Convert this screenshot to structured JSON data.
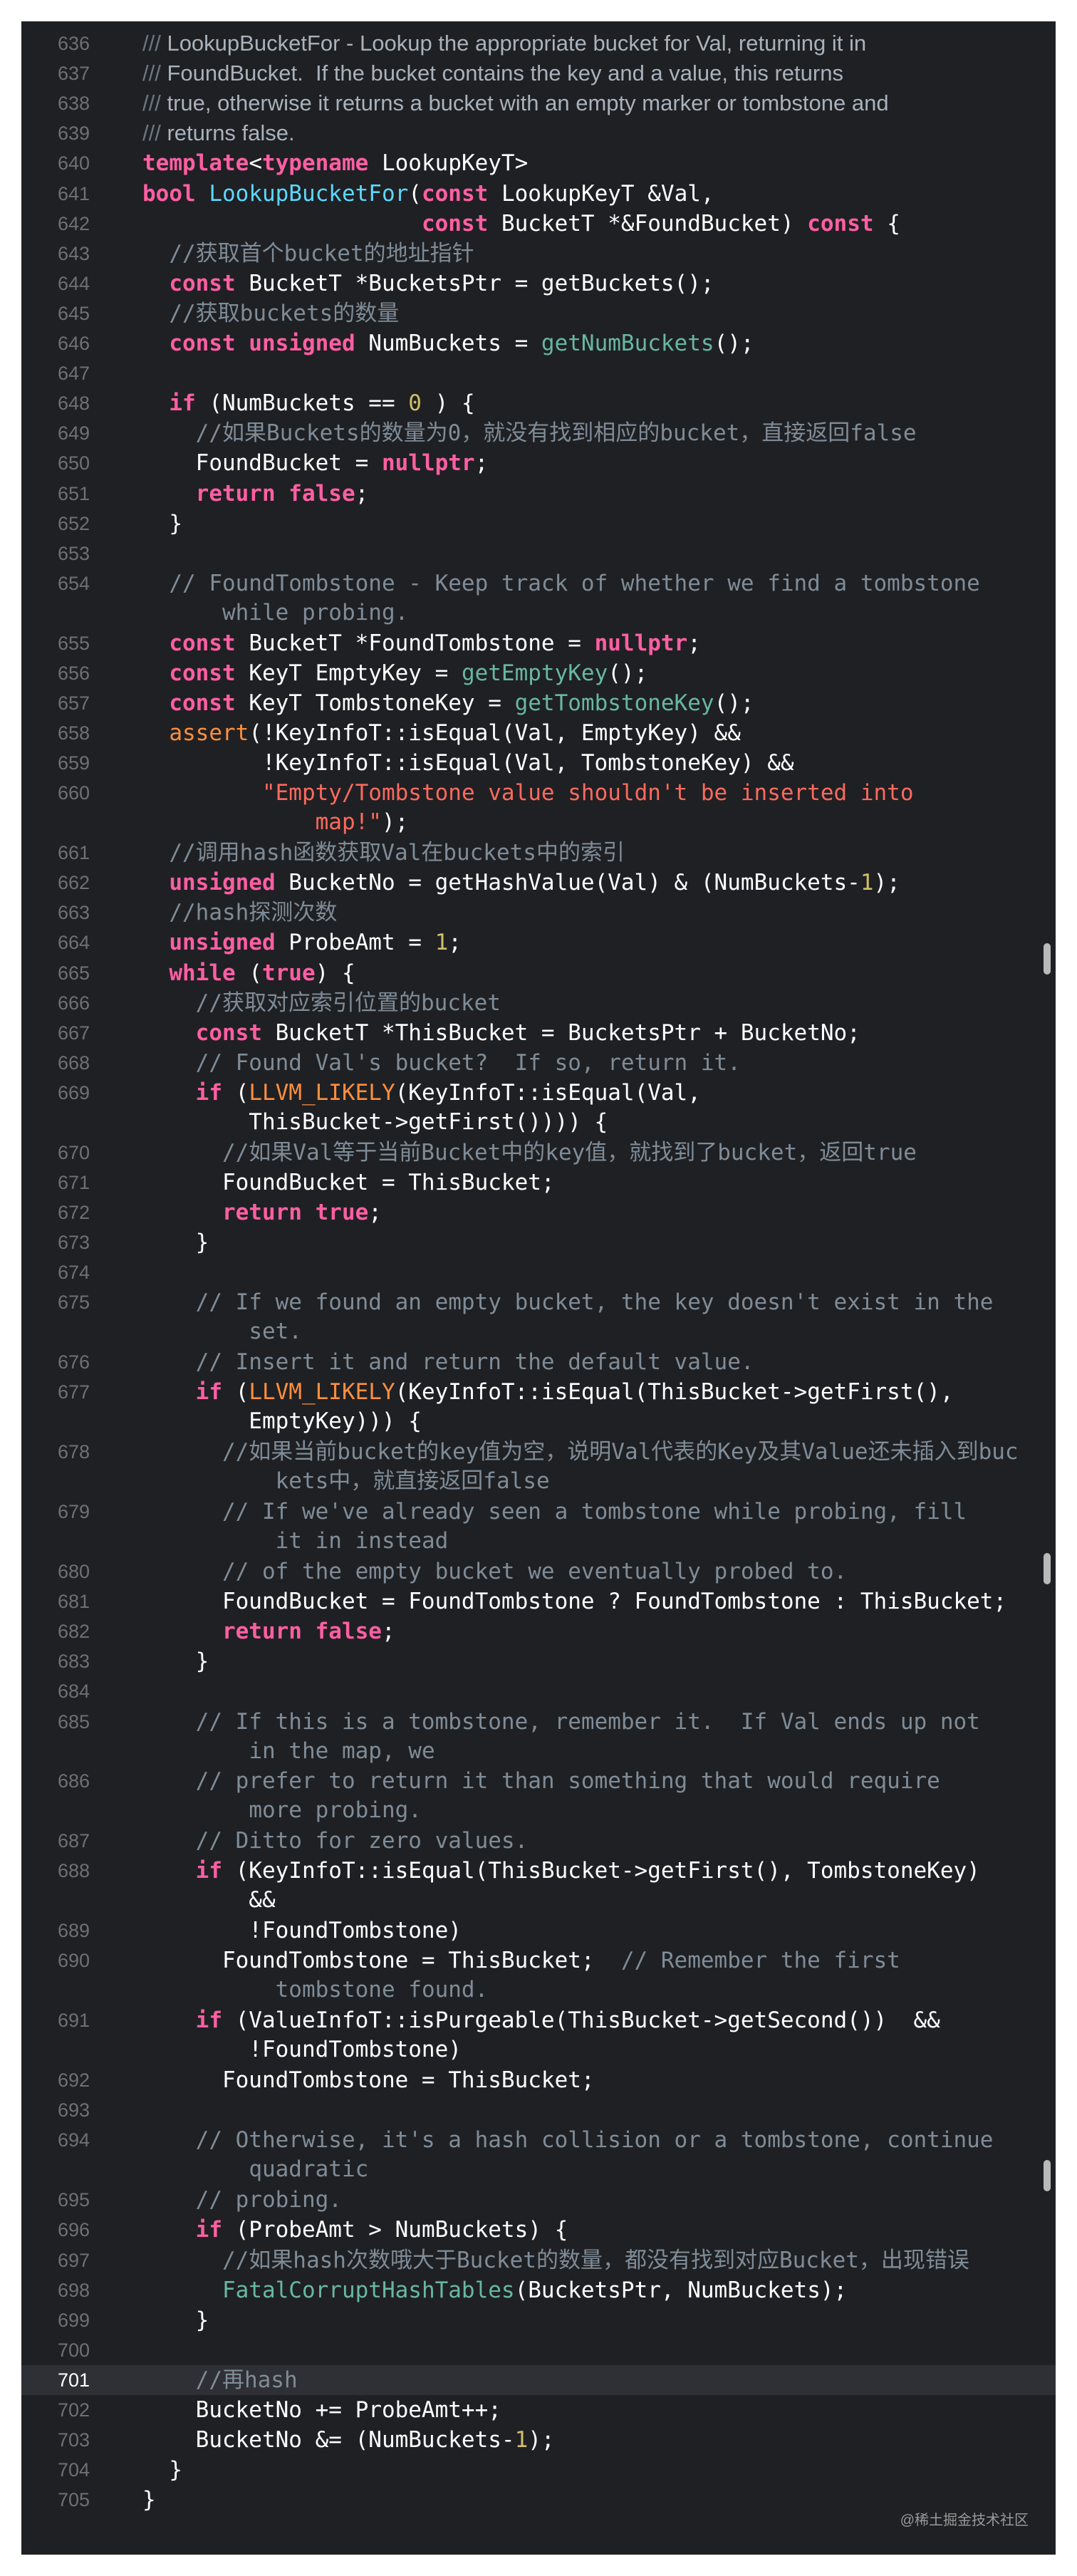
{
  "colors": {
    "background": "#1f2023",
    "keyword": "#fc5fa3",
    "comment": "#7f8c98",
    "string": "#fc6a5d",
    "number": "#d0bf69",
    "function": "#67b7a4",
    "macro": "#fd8f3f",
    "declaration": "#5dd8ff",
    "line_number": "#6e7074",
    "current_line": "#2f3035"
  },
  "editor": {
    "current_line": 701,
    "lines": [
      {
        "num": "636",
        "font": "doc",
        "segs": [
          [
            "cd",
            "/// "
          ],
          [
            "cdt",
            "LookupBucketFor - Lookup the appropriate bucket for Val, returning it in"
          ]
        ]
      },
      {
        "num": "637",
        "font": "doc",
        "segs": [
          [
            "cd",
            "/// "
          ],
          [
            "cdt",
            "FoundBucket.  If the bucket contains the key and a value, this returns"
          ]
        ]
      },
      {
        "num": "638",
        "font": "doc",
        "segs": [
          [
            "cd",
            "/// "
          ],
          [
            "cdt",
            "true, otherwise it returns a bucket with an empty marker or tombstone and"
          ]
        ]
      },
      {
        "num": "639",
        "font": "doc",
        "segs": [
          [
            "cd",
            "/// "
          ],
          [
            "cdt",
            "returns false."
          ]
        ]
      },
      {
        "num": "640",
        "segs": [
          [
            "k",
            "template"
          ],
          [
            "",
            "<"
          ],
          [
            "k",
            "typename"
          ],
          [
            "",
            " LookupKeyT>"
          ]
        ]
      },
      {
        "num": "641",
        "segs": [
          [
            "k",
            "bool"
          ],
          [
            "",
            " "
          ],
          [
            "t",
            "LookupBucketFor"
          ],
          [
            "",
            "("
          ],
          [
            "k",
            "const"
          ],
          [
            "",
            " LookupKeyT &Val,"
          ]
        ]
      },
      {
        "num": "642",
        "segs": [
          [
            "",
            "                     "
          ],
          [
            "k",
            "const"
          ],
          [
            "",
            " BucketT *&FoundBucket) "
          ],
          [
            "k",
            "const"
          ],
          [
            "",
            " {"
          ]
        ]
      },
      {
        "num": "643",
        "segs": [
          [
            "",
            "  "
          ],
          [
            "c",
            "//获取首个bucket的地址指针"
          ]
        ]
      },
      {
        "num": "644",
        "segs": [
          [
            "",
            "  "
          ],
          [
            "k",
            "const"
          ],
          [
            "",
            " BucketT *BucketsPtr = getBuckets();"
          ]
        ]
      },
      {
        "num": "645",
        "segs": [
          [
            "",
            "  "
          ],
          [
            "c",
            "//获取buckets的数量"
          ]
        ]
      },
      {
        "num": "646",
        "segs": [
          [
            "",
            "  "
          ],
          [
            "k",
            "const unsigned"
          ],
          [
            "",
            " NumBuckets = "
          ],
          [
            "f",
            "getNumBuckets"
          ],
          [
            "",
            "();"
          ]
        ]
      },
      {
        "num": "647",
        "segs": []
      },
      {
        "num": "648",
        "segs": [
          [
            "",
            "  "
          ],
          [
            "k",
            "if"
          ],
          [
            "",
            " (NumBuckets == "
          ],
          [
            "n",
            "0"
          ],
          [
            "",
            " ) {"
          ]
        ]
      },
      {
        "num": "649",
        "segs": [
          [
            "",
            "    "
          ],
          [
            "c",
            "//如果Buckets的数量为0，就没有找到相应的bucket，直接返回false"
          ]
        ]
      },
      {
        "num": "650",
        "segs": [
          [
            "",
            "    FoundBucket = "
          ],
          [
            "k",
            "nullptr"
          ],
          [
            "",
            ";"
          ]
        ]
      },
      {
        "num": "651",
        "segs": [
          [
            "",
            "    "
          ],
          [
            "k",
            "return false"
          ],
          [
            "",
            ";"
          ]
        ]
      },
      {
        "num": "652",
        "segs": [
          [
            "",
            "  }"
          ]
        ]
      },
      {
        "num": "653",
        "segs": []
      },
      {
        "num": "654",
        "segs": [
          [
            "",
            "  "
          ],
          [
            "c",
            "// FoundTombstone - Keep track of whether we find a tombstone"
          ]
        ],
        "wrap": [
          [
            "",
            "      "
          ],
          [
            "c",
            "while probing."
          ]
        ]
      },
      {
        "num": "655",
        "segs": [
          [
            "",
            "  "
          ],
          [
            "k",
            "const"
          ],
          [
            "",
            " BucketT *FoundTombstone = "
          ],
          [
            "k",
            "nullptr"
          ],
          [
            "",
            ";"
          ]
        ]
      },
      {
        "num": "656",
        "segs": [
          [
            "",
            "  "
          ],
          [
            "k",
            "const"
          ],
          [
            "",
            " KeyT EmptyKey = "
          ],
          [
            "f",
            "getEmptyKey"
          ],
          [
            "",
            "();"
          ]
        ]
      },
      {
        "num": "657",
        "segs": [
          [
            "",
            "  "
          ],
          [
            "k",
            "const"
          ],
          [
            "",
            " KeyT TombstoneKey = "
          ],
          [
            "f",
            "getTombstoneKey"
          ],
          [
            "",
            "();"
          ]
        ]
      },
      {
        "num": "658",
        "segs": [
          [
            "",
            "  "
          ],
          [
            "m",
            "assert"
          ],
          [
            "",
            "(!KeyInfoT::isEqual(Val, EmptyKey) &&"
          ]
        ]
      },
      {
        "num": "659",
        "segs": [
          [
            "",
            "         !KeyInfoT::isEqual(Val, TombstoneKey) &&"
          ]
        ]
      },
      {
        "num": "660",
        "segs": [
          [
            "",
            "         "
          ],
          [
            "s",
            "\"Empty/Tombstone value shouldn't be inserted into"
          ]
        ],
        "wrap": [
          [
            "",
            "             "
          ],
          [
            "s",
            "map!\""
          ],
          [
            "",
            ");"
          ]
        ]
      },
      {
        "num": "661",
        "segs": [
          [
            "",
            "  "
          ],
          [
            "c",
            "//调用hash函数获取Val在buckets中的索引"
          ]
        ]
      },
      {
        "num": "662",
        "segs": [
          [
            "",
            "  "
          ],
          [
            "k",
            "unsigned"
          ],
          [
            "",
            " BucketNo = getHashValue(Val) & (NumBuckets-"
          ],
          [
            "n",
            "1"
          ],
          [
            "",
            ");"
          ]
        ]
      },
      {
        "num": "663",
        "segs": [
          [
            "",
            "  "
          ],
          [
            "c",
            "//hash探测次数"
          ]
        ]
      },
      {
        "num": "664",
        "segs": [
          [
            "",
            "  "
          ],
          [
            "k",
            "unsigned"
          ],
          [
            "",
            " ProbeAmt = "
          ],
          [
            "n",
            "1"
          ],
          [
            "",
            ";"
          ]
        ]
      },
      {
        "num": "665",
        "segs": [
          [
            "",
            "  "
          ],
          [
            "k",
            "while"
          ],
          [
            "",
            " ("
          ],
          [
            "k",
            "true"
          ],
          [
            "",
            ") {"
          ]
        ]
      },
      {
        "num": "666",
        "segs": [
          [
            "",
            "    "
          ],
          [
            "c",
            "//获取对应索引位置的bucket"
          ]
        ]
      },
      {
        "num": "667",
        "segs": [
          [
            "",
            "    "
          ],
          [
            "k",
            "const"
          ],
          [
            "",
            " BucketT *ThisBucket = BucketsPtr + BucketNo;"
          ]
        ]
      },
      {
        "num": "668",
        "segs": [
          [
            "",
            "    "
          ],
          [
            "c",
            "// Found Val's bucket?  If so, return it."
          ]
        ]
      },
      {
        "num": "669",
        "segs": [
          [
            "",
            "    "
          ],
          [
            "k",
            "if"
          ],
          [
            "",
            " ("
          ],
          [
            "m",
            "LLVM_LIKELY"
          ],
          [
            "",
            "(KeyInfoT::isEqual(Val,"
          ]
        ],
        "wrap": [
          [
            "",
            "        ThisBucket->getFirst()))) {"
          ]
        ]
      },
      {
        "num": "670",
        "segs": [
          [
            "",
            "      "
          ],
          [
            "c",
            "//如果Val等于当前Bucket中的key值，就找到了bucket，返回true"
          ]
        ]
      },
      {
        "num": "671",
        "segs": [
          [
            "",
            "      FoundBucket = ThisBucket;"
          ]
        ]
      },
      {
        "num": "672",
        "segs": [
          [
            "",
            "      "
          ],
          [
            "k",
            "return true"
          ],
          [
            "",
            ";"
          ]
        ]
      },
      {
        "num": "673",
        "segs": [
          [
            "",
            "    }"
          ]
        ]
      },
      {
        "num": "674",
        "segs": []
      },
      {
        "num": "675",
        "segs": [
          [
            "",
            "    "
          ],
          [
            "c",
            "// If we found an empty bucket, the key doesn't exist in the"
          ]
        ],
        "wrap": [
          [
            "",
            "        "
          ],
          [
            "c",
            "set."
          ]
        ]
      },
      {
        "num": "676",
        "segs": [
          [
            "",
            "    "
          ],
          [
            "c",
            "// Insert it and return the default value."
          ]
        ]
      },
      {
        "num": "677",
        "segs": [
          [
            "",
            "    "
          ],
          [
            "k",
            "if"
          ],
          [
            "",
            " ("
          ],
          [
            "m",
            "LLVM_LIKELY"
          ],
          [
            "",
            "(KeyInfoT::isEqual(ThisBucket->getFirst(),"
          ]
        ],
        "wrap": [
          [
            "",
            "        EmptyKey))) {"
          ]
        ]
      },
      {
        "num": "678",
        "segs": [
          [
            "",
            "      "
          ],
          [
            "c",
            "//如果当前bucket的key值为空，说明Val代表的Key及其Value还未插入到buc"
          ]
        ],
        "wrap": [
          [
            "",
            "          "
          ],
          [
            "c",
            "kets中，就直接返回false"
          ]
        ]
      },
      {
        "num": "679",
        "segs": [
          [
            "",
            "      "
          ],
          [
            "c",
            "// If we've already seen a tombstone while probing, fill"
          ]
        ],
        "wrap": [
          [
            "",
            "          "
          ],
          [
            "c",
            "it in instead"
          ]
        ]
      },
      {
        "num": "680",
        "segs": [
          [
            "",
            "      "
          ],
          [
            "c",
            "// of the empty bucket we eventually probed to."
          ]
        ]
      },
      {
        "num": "681",
        "segs": [
          [
            "",
            "      FoundBucket = FoundTombstone ? FoundTombstone : ThisBucket;"
          ]
        ]
      },
      {
        "num": "682",
        "segs": [
          [
            "",
            "      "
          ],
          [
            "k",
            "return false"
          ],
          [
            "",
            ";"
          ]
        ]
      },
      {
        "num": "683",
        "segs": [
          [
            "",
            "    }"
          ]
        ]
      },
      {
        "num": "684",
        "segs": []
      },
      {
        "num": "685",
        "segs": [
          [
            "",
            "    "
          ],
          [
            "c",
            "// If this is a tombstone, remember it.  If Val ends up not"
          ]
        ],
        "wrap": [
          [
            "",
            "        "
          ],
          [
            "c",
            "in the map, we"
          ]
        ]
      },
      {
        "num": "686",
        "segs": [
          [
            "",
            "    "
          ],
          [
            "c",
            "// prefer to return it than something that would require"
          ]
        ],
        "wrap": [
          [
            "",
            "        "
          ],
          [
            "c",
            "more probing."
          ]
        ]
      },
      {
        "num": "687",
        "segs": [
          [
            "",
            "    "
          ],
          [
            "c",
            "// Ditto for zero values."
          ]
        ]
      },
      {
        "num": "688",
        "segs": [
          [
            "",
            "    "
          ],
          [
            "k",
            "if"
          ],
          [
            "",
            " (KeyInfoT::isEqual(ThisBucket->getFirst(), TombstoneKey)"
          ]
        ],
        "wrap": [
          [
            "",
            "        &&"
          ]
        ]
      },
      {
        "num": "689",
        "segs": [
          [
            "",
            "        !FoundTombstone)"
          ]
        ]
      },
      {
        "num": "690",
        "segs": [
          [
            "",
            "      FoundTombstone = ThisBucket;  "
          ],
          [
            "c",
            "// Remember the first"
          ]
        ],
        "wrap": [
          [
            "",
            "          "
          ],
          [
            "c",
            "tombstone found."
          ]
        ]
      },
      {
        "num": "691",
        "segs": [
          [
            "",
            "    "
          ],
          [
            "k",
            "if"
          ],
          [
            "",
            " (ValueInfoT::isPurgeable(ThisBucket->getSecond())  &&"
          ]
        ],
        "wrap": [
          [
            "",
            "        !FoundTombstone)"
          ]
        ]
      },
      {
        "num": "692",
        "segs": [
          [
            "",
            "      FoundTombstone = ThisBucket;"
          ]
        ]
      },
      {
        "num": "693",
        "segs": []
      },
      {
        "num": "694",
        "segs": [
          [
            "",
            "    "
          ],
          [
            "c",
            "// Otherwise, it's a hash collision or a tombstone, continue"
          ]
        ],
        "wrap": [
          [
            "",
            "        "
          ],
          [
            "c",
            "quadratic"
          ]
        ]
      },
      {
        "num": "695",
        "segs": [
          [
            "",
            "    "
          ],
          [
            "c",
            "// probing."
          ]
        ]
      },
      {
        "num": "696",
        "segs": [
          [
            "",
            "    "
          ],
          [
            "k",
            "if"
          ],
          [
            "",
            " (ProbeAmt > NumBuckets) {"
          ]
        ]
      },
      {
        "num": "697",
        "segs": [
          [
            "",
            "      "
          ],
          [
            "c",
            "//如果hash次数哦大于Bucket的数量，都没有找到对应Bucket，出现错误"
          ]
        ]
      },
      {
        "num": "698",
        "segs": [
          [
            "",
            "      "
          ],
          [
            "f",
            "FatalCorruptHashTables"
          ],
          [
            "",
            "(BucketsPtr, NumBuckets);"
          ]
        ]
      },
      {
        "num": "699",
        "segs": [
          [
            "",
            "    }"
          ]
        ]
      },
      {
        "num": "700",
        "segs": []
      },
      {
        "num": "701",
        "segs": [
          [
            "",
            "    "
          ],
          [
            "c",
            "//再hash"
          ]
        ]
      },
      {
        "num": "702",
        "segs": [
          [
            "",
            "    BucketNo += ProbeAmt++;"
          ]
        ]
      },
      {
        "num": "703",
        "segs": [
          [
            "",
            "    BucketNo &= (NumBuckets-"
          ],
          [
            "n",
            "1"
          ],
          [
            "",
            ");"
          ]
        ]
      },
      {
        "num": "704",
        "segs": [
          [
            "",
            "  }"
          ]
        ]
      },
      {
        "num": "705",
        "segs": [
          [
            "",
            "}"
          ]
        ]
      }
    ]
  },
  "watermark": "@稀土掘金技术社区"
}
